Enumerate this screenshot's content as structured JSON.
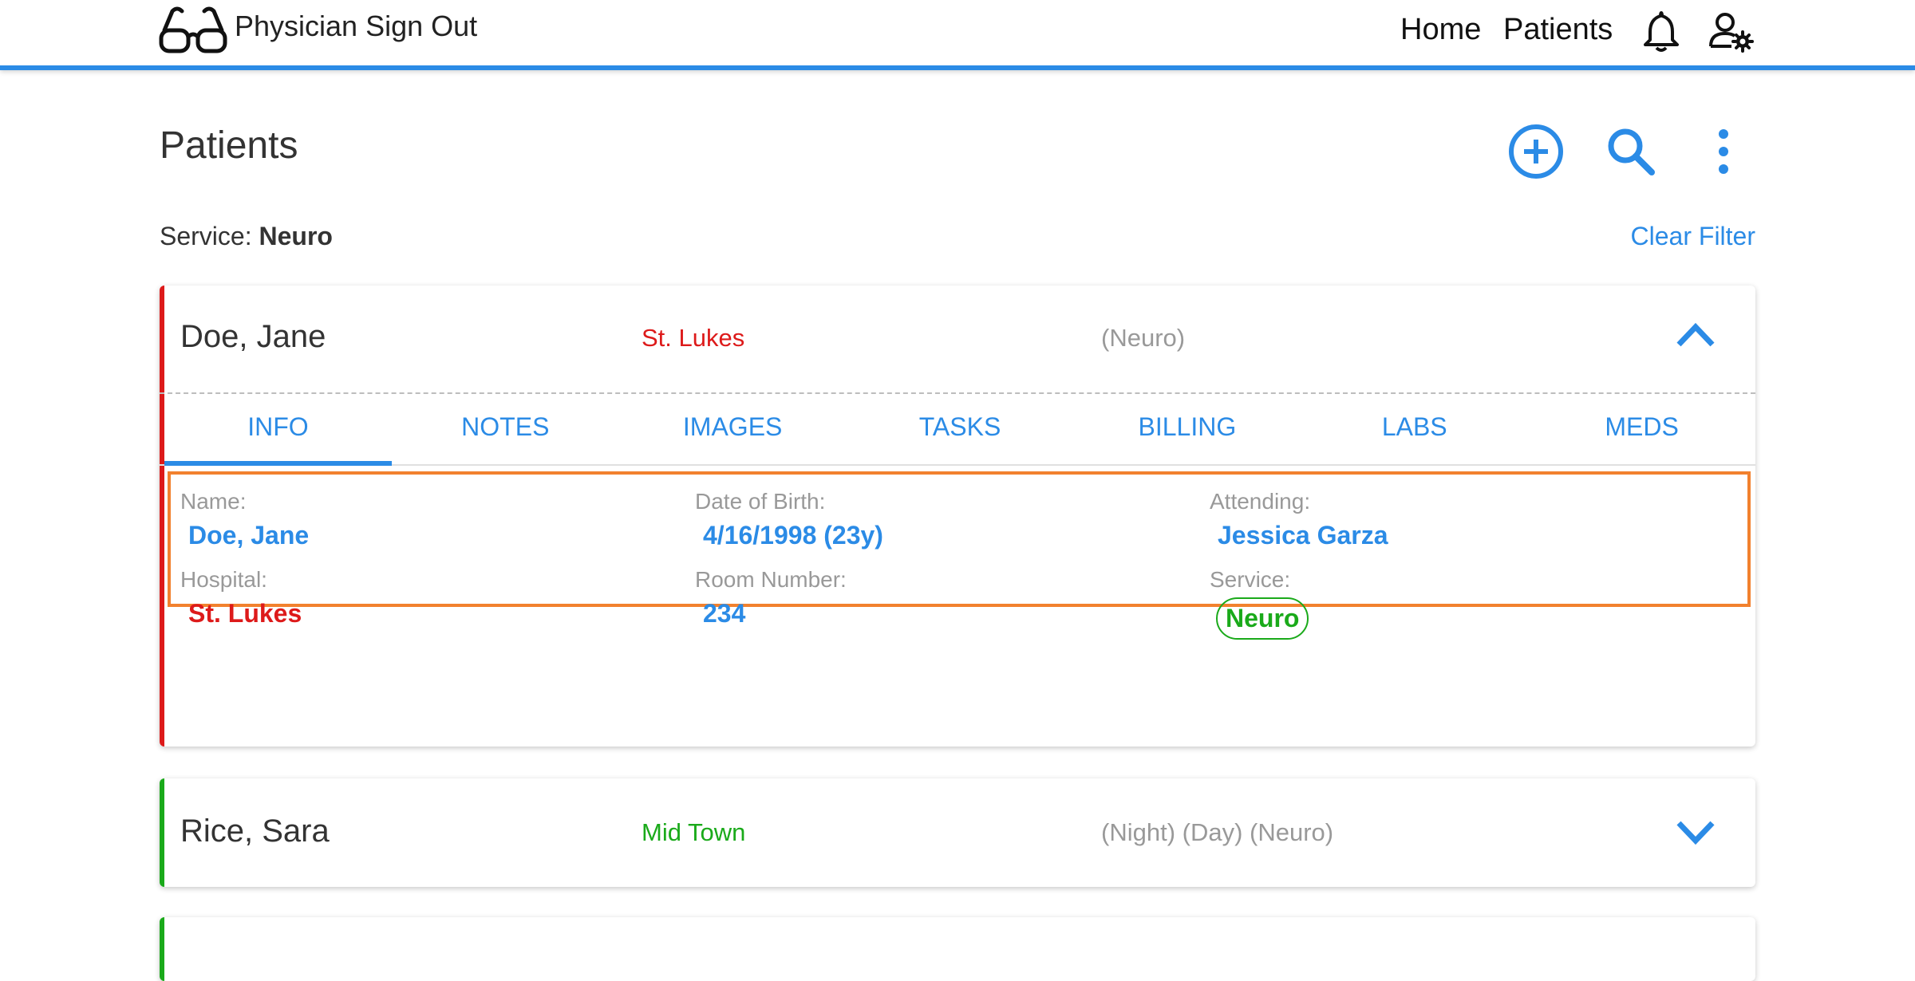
{
  "app": {
    "title": "Physician Sign Out",
    "nav": {
      "home": "Home",
      "patients": "Patients"
    }
  },
  "page": {
    "title": "Patients",
    "filter_label": "Service:",
    "filter_value": "Neuro",
    "clear_filter": "Clear Filter"
  },
  "colors": {
    "accent": "#2b8be6",
    "hospital_red": "#dd1a1a",
    "hospital_green": "#1aaa1a",
    "highlight": "#f2812e"
  },
  "patients": [
    {
      "name": "Doe, Jane",
      "hospital": "St. Lukes",
      "services": "(Neuro)",
      "expanded": true,
      "tabs": [
        "INFO",
        "NOTES",
        "IMAGES",
        "TASKS",
        "BILLING",
        "LABS",
        "MEDS"
      ],
      "active_tab": "INFO",
      "info": {
        "name_label": "Name:",
        "name": "Doe, Jane",
        "dob_label": "Date of Birth:",
        "dob": "4/16/1998 (23y)",
        "attending_label": "Attending:",
        "attending": "Jessica Garza",
        "hospital_label": "Hospital:",
        "hospital": "St. Lukes",
        "room_label": "Room Number:",
        "room": "234",
        "service_label": "Service:",
        "service": "Neuro"
      }
    },
    {
      "name": "Rice, Sara",
      "hospital": "Mid Town",
      "services": "(Night) (Day) (Neuro)",
      "expanded": false
    }
  ],
  "icons": {
    "logo": "glasses-icon",
    "notifications": "bell-icon",
    "account": "user-settings-icon",
    "add": "add-circle-icon",
    "search": "search-icon",
    "more": "more-vert-icon",
    "collapse": "chevron-up-icon",
    "expand": "chevron-down-icon",
    "settings": "gear-icon",
    "edit": "pencil-icon"
  }
}
